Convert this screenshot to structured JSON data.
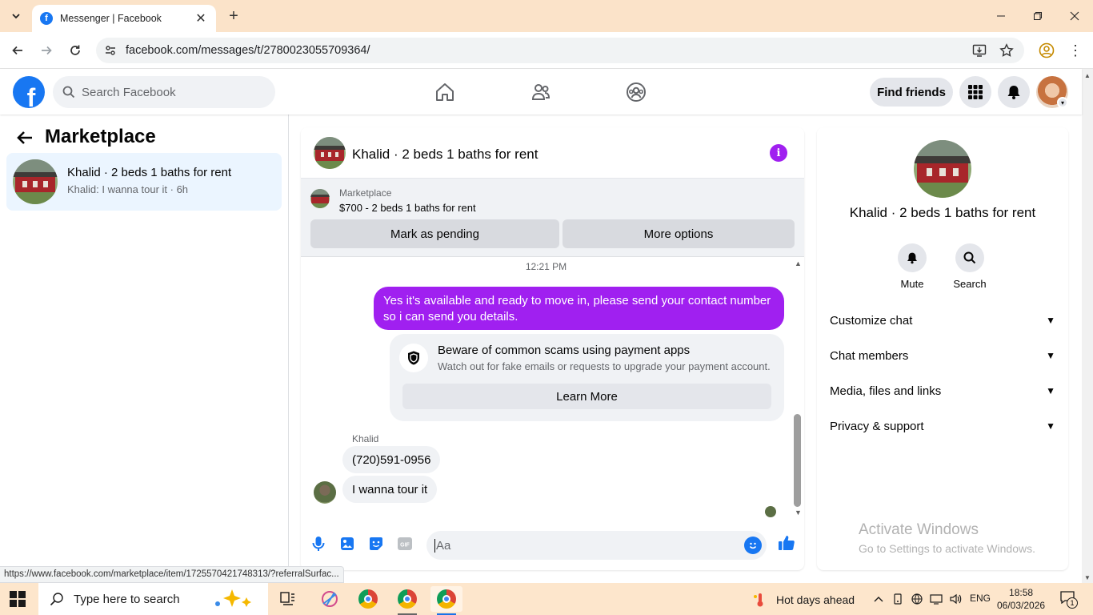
{
  "browser": {
    "tab_title": "Messenger | Facebook",
    "url": "facebook.com/messages/t/2780023055709364/",
    "status_url": "https://www.facebook.com/marketplace/item/1725570421748313/?referralSurfac..."
  },
  "fb_header": {
    "logo_letter": "f",
    "search_placeholder": "Search Facebook",
    "find_friends_label": "Find friends"
  },
  "left_panel": {
    "title": "Marketplace",
    "conversations": [
      {
        "name": "Khalid · 2 beds 1 baths for rent",
        "snippet": "Khalid: I wanna tour it · 6h"
      }
    ]
  },
  "chat": {
    "title": "Khalid · 2 beds 1 baths for rent",
    "info_glyph": "i",
    "listing": {
      "source": "Marketplace",
      "description": "$700 - 2 beds 1 baths for rent",
      "mark_pending_label": "Mark as pending",
      "more_options_label": "More options"
    },
    "timestamp": "12:21 PM",
    "outgoing_message": "Yes it's available and ready to move in, please send your contact number so i can send you details.",
    "scam_notice": {
      "title": "Beware of common scams using payment apps",
      "body": "Watch out for fake emails or requests to upgrade your payment account.",
      "button_label": "Learn More"
    },
    "sender_name": "Khalid",
    "incoming_messages": [
      "(720)591-0956",
      "I wanna tour it"
    ],
    "composer_placeholder": "Aa"
  },
  "details": {
    "name": "Khalid · 2 beds 1 baths for rent",
    "actions": [
      {
        "label": "Mute",
        "icon": "bell-icon"
      },
      {
        "label": "Search",
        "icon": "search-icon"
      }
    ],
    "sections": [
      "Customize chat",
      "Chat members",
      "Media, files and links",
      "Privacy & support"
    ]
  },
  "watermark": {
    "line1": "Activate Windows",
    "line2": "Go to Settings to activate Windows."
  },
  "taskbar": {
    "search_placeholder": "Type here to search",
    "weather": "Hot days ahead",
    "language": "ENG",
    "time": "18:58",
    "date": "06/03/2026",
    "notification_count": "1"
  },
  "colors": {
    "messenger_purple": "#a020f0",
    "facebook_blue": "#1877f2",
    "selected_conversation_bg": "#ebf5ff"
  }
}
